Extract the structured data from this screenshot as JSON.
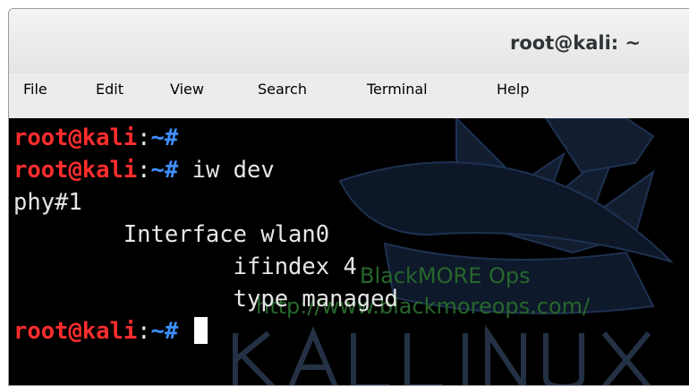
{
  "window": {
    "title": "root@kali: ~"
  },
  "menu": [
    "File",
    "Edit",
    "View",
    "Search",
    "Terminal",
    "Help"
  ],
  "terminal": {
    "prompt_user": "root@kali",
    "prompt_sep": ":",
    "prompt_path": "~#",
    "lines": [
      {
        "kind": "prompt",
        "command": ""
      },
      {
        "kind": "prompt",
        "command": " iw dev"
      },
      {
        "kind": "output",
        "text": "phy#1"
      },
      {
        "kind": "output",
        "text": "        Interface wlan0"
      },
      {
        "kind": "output",
        "text": "                ifindex 4"
      },
      {
        "kind": "output",
        "text": "                type managed"
      },
      {
        "kind": "prompt",
        "command": " "
      }
    ],
    "watermark_title": "BlackMORE Ops",
    "watermark_url": "http://www.blackmoreops.com/"
  },
  "colors": {
    "user": "#ff2d2d",
    "path": "#3f8fff",
    "text": "#e6e6e6",
    "background": "#000000"
  },
  "icons": {
    "background_logo": "kali-linux-dragon-logo"
  }
}
